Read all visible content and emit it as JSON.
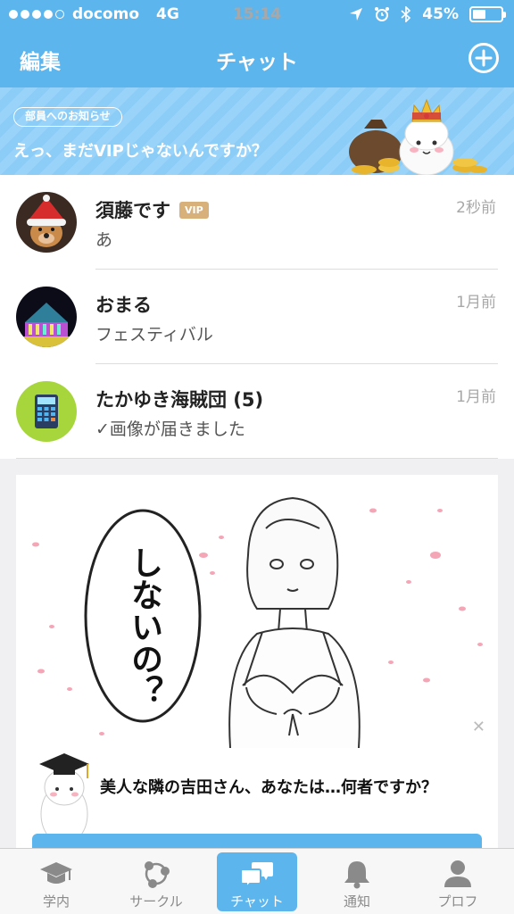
{
  "status_bar": {
    "carrier": "docomo",
    "network": "4G",
    "time": "15:14",
    "battery": "45%"
  },
  "header": {
    "edit_label": "編集",
    "title": "チャット"
  },
  "banner": {
    "tag": "部員へのお知らせ",
    "message": "えっ、まだVIPじゃないんですか？"
  },
  "chats": [
    {
      "name": "須藤です",
      "badge": "VIP",
      "preview": "あ",
      "time": "2秒前",
      "avatar": "dog-santa-avatar"
    },
    {
      "name": "おまる",
      "badge": "",
      "preview": "フェスティバル",
      "time": "1月前",
      "avatar": "illuminated-building-avatar"
    },
    {
      "name": "たかゆき海賊団 (5)",
      "badge": "",
      "preview": "✓画像が届きました",
      "time": "1月前",
      "avatar": "calculator-avatar"
    }
  ],
  "ad": {
    "speech": "しないの？",
    "caption": "美人な隣の吉田さん、あなたは…何者ですか？"
  },
  "tabs": [
    {
      "label": "学内",
      "icon": "graduation-cap-icon",
      "active": false
    },
    {
      "label": "サークル",
      "icon": "circle-network-icon",
      "active": false
    },
    {
      "label": "チャット",
      "icon": "chat-bubbles-icon",
      "active": true
    },
    {
      "label": "通知",
      "icon": "bell-icon",
      "active": false
    },
    {
      "label": "プロフ",
      "icon": "person-icon",
      "active": false
    }
  ],
  "colors": {
    "primary": "#5db5ee",
    "banner": "#8ccdf8",
    "vip_badge": "#d8b07a"
  }
}
